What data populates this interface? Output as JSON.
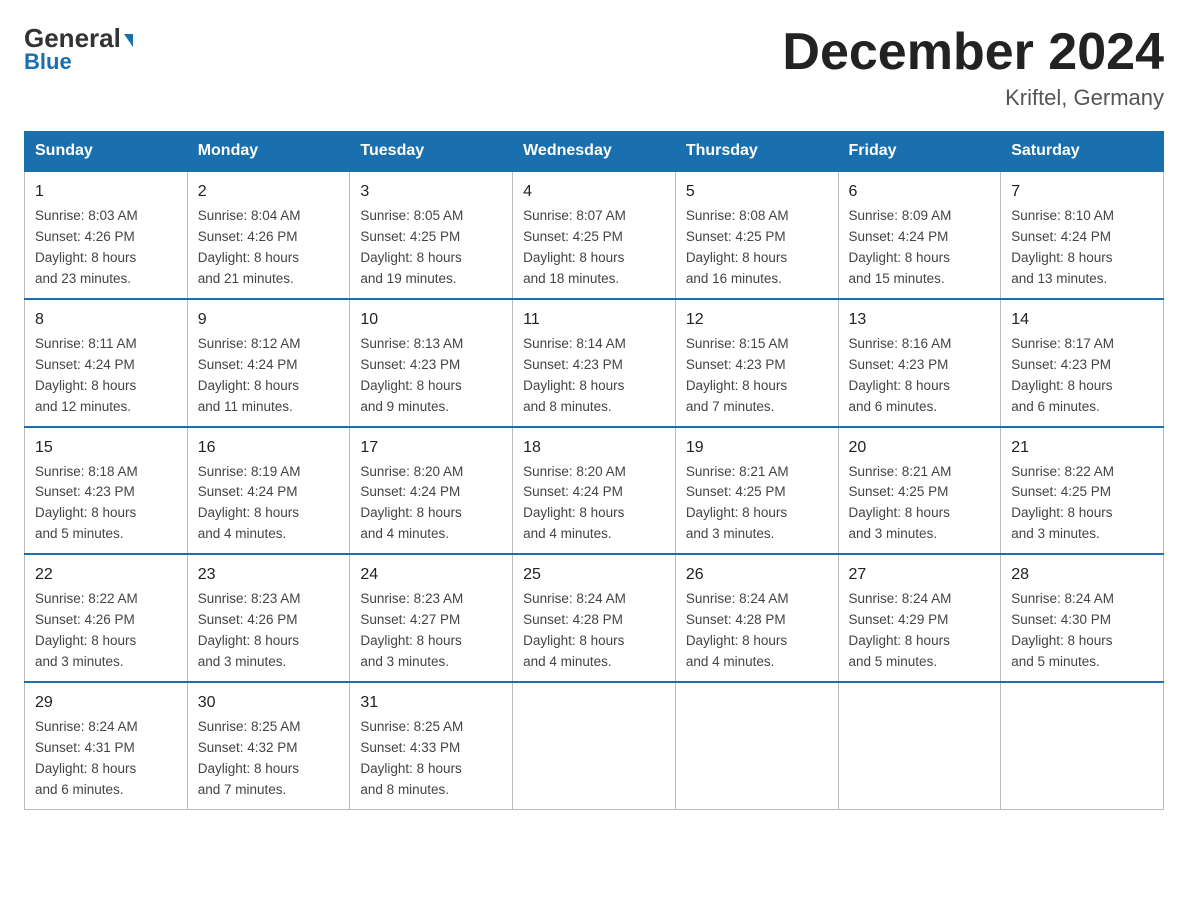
{
  "header": {
    "logo_top": "General",
    "logo_bottom": "Blue",
    "month_title": "December 2024",
    "location": "Kriftel, Germany"
  },
  "weekdays": [
    "Sunday",
    "Monday",
    "Tuesday",
    "Wednesday",
    "Thursday",
    "Friday",
    "Saturday"
  ],
  "weeks": [
    [
      {
        "day": "1",
        "sunrise": "8:03 AM",
        "sunset": "4:26 PM",
        "daylight": "8 hours and 23 minutes."
      },
      {
        "day": "2",
        "sunrise": "8:04 AM",
        "sunset": "4:26 PM",
        "daylight": "8 hours and 21 minutes."
      },
      {
        "day": "3",
        "sunrise": "8:05 AM",
        "sunset": "4:25 PM",
        "daylight": "8 hours and 19 minutes."
      },
      {
        "day": "4",
        "sunrise": "8:07 AM",
        "sunset": "4:25 PM",
        "daylight": "8 hours and 18 minutes."
      },
      {
        "day": "5",
        "sunrise": "8:08 AM",
        "sunset": "4:25 PM",
        "daylight": "8 hours and 16 minutes."
      },
      {
        "day": "6",
        "sunrise": "8:09 AM",
        "sunset": "4:24 PM",
        "daylight": "8 hours and 15 minutes."
      },
      {
        "day": "7",
        "sunrise": "8:10 AM",
        "sunset": "4:24 PM",
        "daylight": "8 hours and 13 minutes."
      }
    ],
    [
      {
        "day": "8",
        "sunrise": "8:11 AM",
        "sunset": "4:24 PM",
        "daylight": "8 hours and 12 minutes."
      },
      {
        "day": "9",
        "sunrise": "8:12 AM",
        "sunset": "4:24 PM",
        "daylight": "8 hours and 11 minutes."
      },
      {
        "day": "10",
        "sunrise": "8:13 AM",
        "sunset": "4:23 PM",
        "daylight": "8 hours and 9 minutes."
      },
      {
        "day": "11",
        "sunrise": "8:14 AM",
        "sunset": "4:23 PM",
        "daylight": "8 hours and 8 minutes."
      },
      {
        "day": "12",
        "sunrise": "8:15 AM",
        "sunset": "4:23 PM",
        "daylight": "8 hours and 7 minutes."
      },
      {
        "day": "13",
        "sunrise": "8:16 AM",
        "sunset": "4:23 PM",
        "daylight": "8 hours and 6 minutes."
      },
      {
        "day": "14",
        "sunrise": "8:17 AM",
        "sunset": "4:23 PM",
        "daylight": "8 hours and 6 minutes."
      }
    ],
    [
      {
        "day": "15",
        "sunrise": "8:18 AM",
        "sunset": "4:23 PM",
        "daylight": "8 hours and 5 minutes."
      },
      {
        "day": "16",
        "sunrise": "8:19 AM",
        "sunset": "4:24 PM",
        "daylight": "8 hours and 4 minutes."
      },
      {
        "day": "17",
        "sunrise": "8:20 AM",
        "sunset": "4:24 PM",
        "daylight": "8 hours and 4 minutes."
      },
      {
        "day": "18",
        "sunrise": "8:20 AM",
        "sunset": "4:24 PM",
        "daylight": "8 hours and 4 minutes."
      },
      {
        "day": "19",
        "sunrise": "8:21 AM",
        "sunset": "4:25 PM",
        "daylight": "8 hours and 3 minutes."
      },
      {
        "day": "20",
        "sunrise": "8:21 AM",
        "sunset": "4:25 PM",
        "daylight": "8 hours and 3 minutes."
      },
      {
        "day": "21",
        "sunrise": "8:22 AM",
        "sunset": "4:25 PM",
        "daylight": "8 hours and 3 minutes."
      }
    ],
    [
      {
        "day": "22",
        "sunrise": "8:22 AM",
        "sunset": "4:26 PM",
        "daylight": "8 hours and 3 minutes."
      },
      {
        "day": "23",
        "sunrise": "8:23 AM",
        "sunset": "4:26 PM",
        "daylight": "8 hours and 3 minutes."
      },
      {
        "day": "24",
        "sunrise": "8:23 AM",
        "sunset": "4:27 PM",
        "daylight": "8 hours and 3 minutes."
      },
      {
        "day": "25",
        "sunrise": "8:24 AM",
        "sunset": "4:28 PM",
        "daylight": "8 hours and 4 minutes."
      },
      {
        "day": "26",
        "sunrise": "8:24 AM",
        "sunset": "4:28 PM",
        "daylight": "8 hours and 4 minutes."
      },
      {
        "day": "27",
        "sunrise": "8:24 AM",
        "sunset": "4:29 PM",
        "daylight": "8 hours and 5 minutes."
      },
      {
        "day": "28",
        "sunrise": "8:24 AM",
        "sunset": "4:30 PM",
        "daylight": "8 hours and 5 minutes."
      }
    ],
    [
      {
        "day": "29",
        "sunrise": "8:24 AM",
        "sunset": "4:31 PM",
        "daylight": "8 hours and 6 minutes."
      },
      {
        "day": "30",
        "sunrise": "8:25 AM",
        "sunset": "4:32 PM",
        "daylight": "8 hours and 7 minutes."
      },
      {
        "day": "31",
        "sunrise": "8:25 AM",
        "sunset": "4:33 PM",
        "daylight": "8 hours and 8 minutes."
      },
      null,
      null,
      null,
      null
    ]
  ],
  "labels": {
    "sunrise": "Sunrise:",
    "sunset": "Sunset:",
    "daylight": "Daylight:"
  }
}
